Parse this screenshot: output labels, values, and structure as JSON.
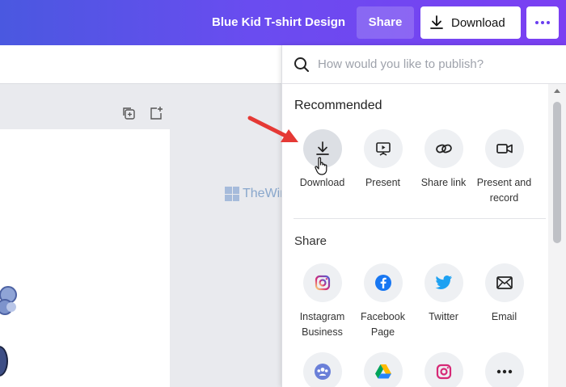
{
  "header": {
    "doc_title": "Blue Kid T-shirt Design",
    "share_label": "Share",
    "download_label": "Download"
  },
  "watermark": "TheWindowsClub",
  "publish": {
    "search_placeholder": "How would you like to publish?",
    "recommended_title": "Recommended",
    "recommended": [
      {
        "label": "Download",
        "icon": "download-icon"
      },
      {
        "label": "Present",
        "icon": "present-icon"
      },
      {
        "label": "Share link",
        "icon": "link-icon"
      },
      {
        "label": "Present and record",
        "icon": "video-camera-icon"
      }
    ],
    "share_title": "Share",
    "share": [
      {
        "label": "Instagram Business",
        "icon": "instagram-icon",
        "color": "#d62976"
      },
      {
        "label": "Facebook Page",
        "icon": "facebook-icon",
        "color": "#1877f2"
      },
      {
        "label": "Twitter",
        "icon": "twitter-icon",
        "color": "#1da1f2"
      },
      {
        "label": "Email",
        "icon": "email-icon"
      }
    ]
  },
  "colors": {
    "accent": "#6a3ff0",
    "header_gradient_start": "#4a58e0",
    "header_gradient_end": "#7b3ff2",
    "arrow": "#e53935"
  }
}
